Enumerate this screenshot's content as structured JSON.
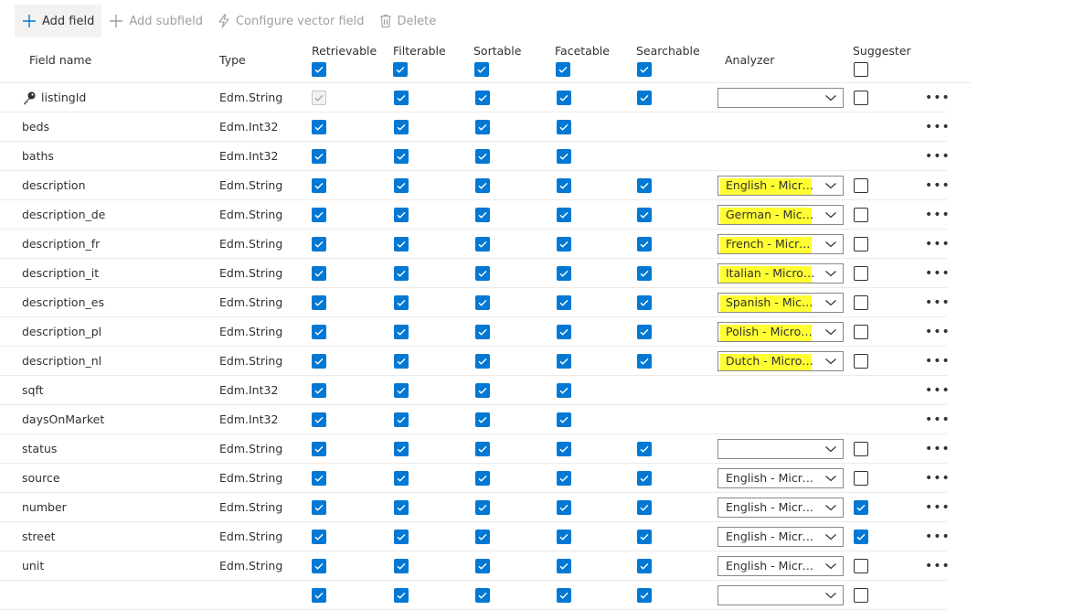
{
  "toolbar": {
    "add_field": "Add field",
    "add_subfield": "Add subfield",
    "configure_vector": "Configure vector field",
    "delete": "Delete"
  },
  "columns": {
    "field_name": "Field name",
    "type": "Type",
    "retrievable": "Retrievable",
    "filterable": "Filterable",
    "sortable": "Sortable",
    "facetable": "Facetable",
    "searchable": "Searchable",
    "analyzer": "Analyzer",
    "suggester": "Suggester"
  },
  "header_checks": {
    "retrievable": true,
    "filterable": true,
    "sortable": true,
    "facetable": true,
    "searchable": true,
    "suggester": false
  },
  "more_label": "•••",
  "highlight_color": "#ffff33",
  "accent_color": "#0078d4",
  "rows": [
    {
      "name": "listingId",
      "type": "Edm.String",
      "key": true,
      "retrievable": "disabled",
      "filterable": true,
      "sortable": true,
      "facetable": true,
      "searchable": true,
      "analyzer": "",
      "suggester": false,
      "highlight": false
    },
    {
      "name": "beds",
      "type": "Edm.Int32",
      "retrievable": true,
      "filterable": true,
      "sortable": true,
      "facetable": true,
      "searchable": null,
      "analyzer": null,
      "suggester": null,
      "highlight": false
    },
    {
      "name": "baths",
      "type": "Edm.Int32",
      "retrievable": true,
      "filterable": true,
      "sortable": true,
      "facetable": true,
      "searchable": null,
      "analyzer": null,
      "suggester": null,
      "highlight": false
    },
    {
      "name": "description",
      "type": "Edm.String",
      "retrievable": true,
      "filterable": true,
      "sortable": true,
      "facetable": true,
      "searchable": true,
      "analyzer": "English - Microsoft",
      "suggester": false,
      "highlight": true
    },
    {
      "name": "description_de",
      "type": "Edm.String",
      "retrievable": true,
      "filterable": true,
      "sortable": true,
      "facetable": true,
      "searchable": true,
      "analyzer": "German - Microsoft",
      "suggester": false,
      "highlight": true
    },
    {
      "name": "description_fr",
      "type": "Edm.String",
      "retrievable": true,
      "filterable": true,
      "sortable": true,
      "facetable": true,
      "searchable": true,
      "analyzer": "French - Microsoft",
      "suggester": false,
      "highlight": true
    },
    {
      "name": "description_it",
      "type": "Edm.String",
      "retrievable": true,
      "filterable": true,
      "sortable": true,
      "facetable": true,
      "searchable": true,
      "analyzer": "Italian - Microsoft",
      "suggester": false,
      "highlight": true
    },
    {
      "name": "description_es",
      "type": "Edm.String",
      "retrievable": true,
      "filterable": true,
      "sortable": true,
      "facetable": true,
      "searchable": true,
      "analyzer": "Spanish - Microsoft",
      "suggester": false,
      "highlight": true
    },
    {
      "name": "description_pl",
      "type": "Edm.String",
      "retrievable": true,
      "filterable": true,
      "sortable": true,
      "facetable": true,
      "searchable": true,
      "analyzer": "Polish - Microsoft",
      "suggester": false,
      "highlight": true
    },
    {
      "name": "description_nl",
      "type": "Edm.String",
      "retrievable": true,
      "filterable": true,
      "sortable": true,
      "facetable": true,
      "searchable": true,
      "analyzer": "Dutch - Microsoft",
      "suggester": false,
      "highlight": true
    },
    {
      "name": "sqft",
      "type": "Edm.Int32",
      "retrievable": true,
      "filterable": true,
      "sortable": true,
      "facetable": true,
      "searchable": null,
      "analyzer": null,
      "suggester": null,
      "highlight": false
    },
    {
      "name": "daysOnMarket",
      "type": "Edm.Int32",
      "retrievable": true,
      "filterable": true,
      "sortable": true,
      "facetable": true,
      "searchable": null,
      "analyzer": null,
      "suggester": null,
      "highlight": false
    },
    {
      "name": "status",
      "type": "Edm.String",
      "retrievable": true,
      "filterable": true,
      "sortable": true,
      "facetable": true,
      "searchable": true,
      "analyzer": "",
      "suggester": false,
      "highlight": false
    },
    {
      "name": "source",
      "type": "Edm.String",
      "retrievable": true,
      "filterable": true,
      "sortable": true,
      "facetable": true,
      "searchable": true,
      "analyzer": "English - Microsoft",
      "suggester": false,
      "highlight": false
    },
    {
      "name": "number",
      "type": "Edm.String",
      "retrievable": true,
      "filterable": true,
      "sortable": true,
      "facetable": true,
      "searchable": true,
      "analyzer": "English - Microsoft",
      "suggester": true,
      "highlight": false
    },
    {
      "name": "street",
      "type": "Edm.String",
      "retrievable": true,
      "filterable": true,
      "sortable": true,
      "facetable": true,
      "searchable": true,
      "analyzer": "English - Microsoft",
      "suggester": true,
      "highlight": false
    },
    {
      "name": "unit",
      "type": "Edm.String",
      "retrievable": true,
      "filterable": true,
      "sortable": true,
      "facetable": true,
      "searchable": true,
      "analyzer": "English - Microsoft",
      "suggester": false,
      "highlight": false
    },
    {
      "name": "",
      "type": "",
      "retrievable": true,
      "filterable": true,
      "sortable": true,
      "facetable": true,
      "searchable": true,
      "analyzer": "",
      "suggester": false,
      "highlight": false
    }
  ]
}
